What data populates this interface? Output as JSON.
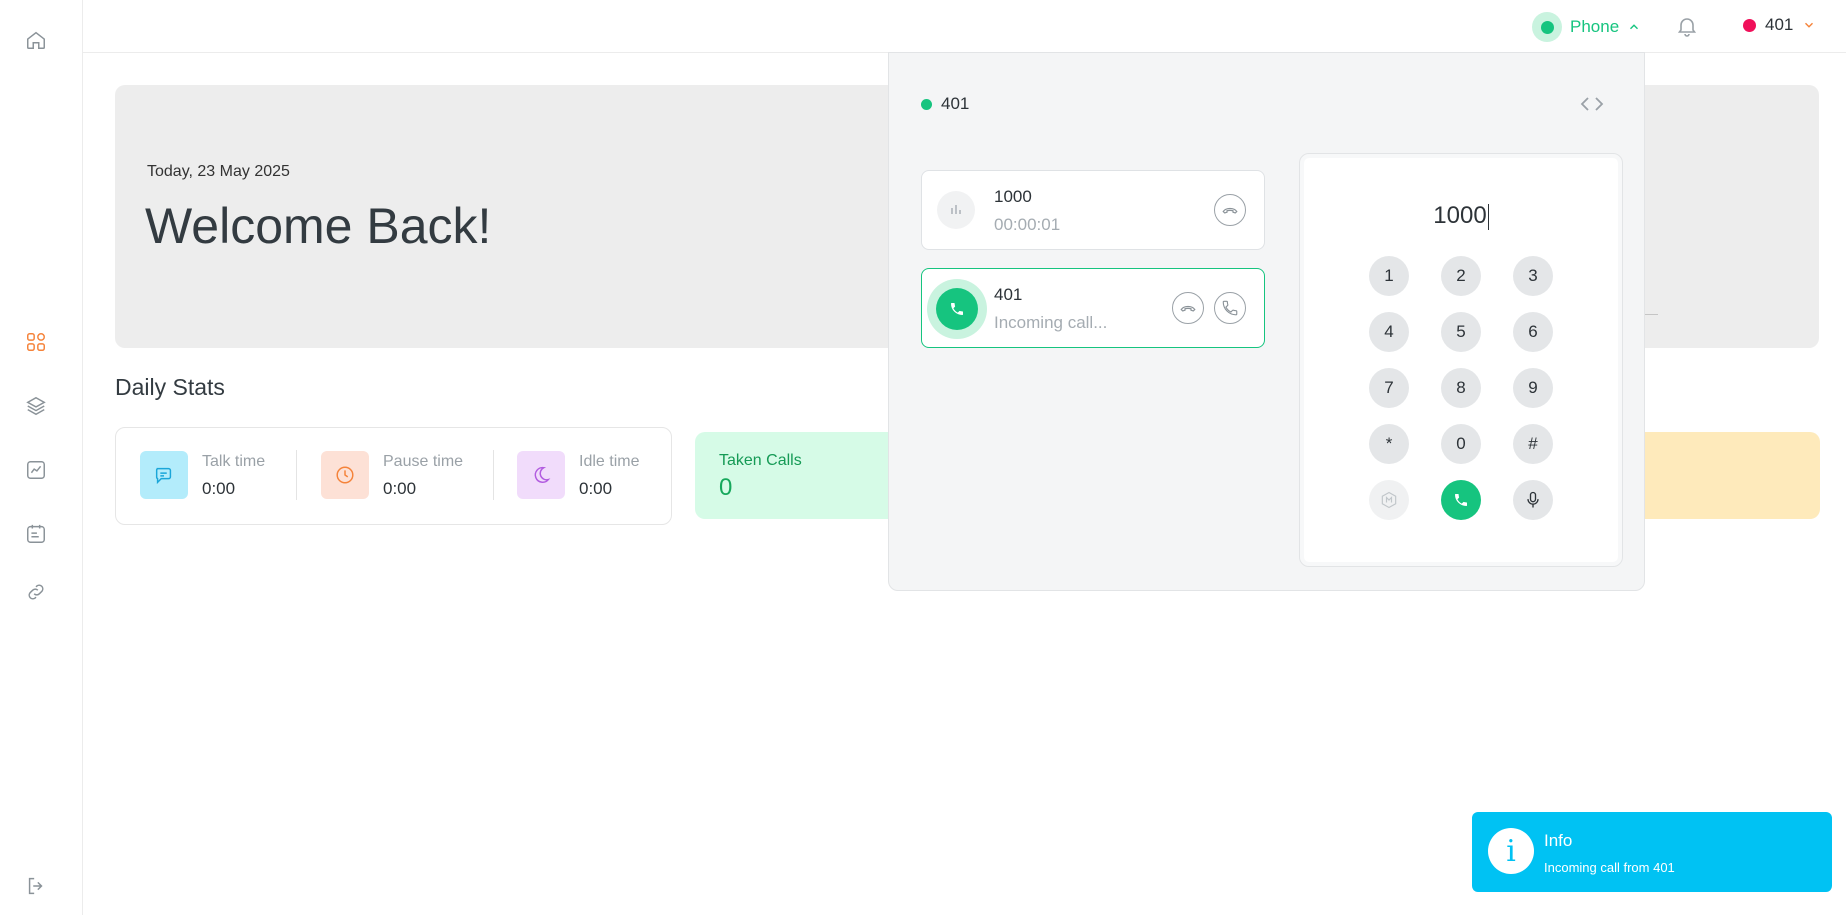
{
  "topbar": {
    "phone_label": "Phone",
    "user_ext": "401"
  },
  "hero": {
    "date": "Today, 23 May 2025",
    "title": "Welcome Back!"
  },
  "daily_stats": {
    "title": "Daily Stats",
    "items": [
      {
        "label": "Talk time",
        "value": "0:00",
        "icon": "chat-icon",
        "color": "#b3ecfb"
      },
      {
        "label": "Pause time",
        "value": "0:00",
        "icon": "clock-icon",
        "color": "#fde1d6"
      },
      {
        "label": "Idle time",
        "value": "0:00",
        "icon": "moon-icon",
        "color": "#f1dcfb"
      }
    ],
    "taken_calls": {
      "label": "Taken Calls",
      "value": "0"
    }
  },
  "phone_panel": {
    "extension": "401",
    "calls": [
      {
        "number": "1000",
        "status": "00:00:01",
        "state": "active"
      },
      {
        "number": "401",
        "status": "Incoming call...",
        "state": "incoming"
      }
    ],
    "dialer": {
      "display": "1000",
      "keys": [
        "1",
        "2",
        "3",
        "4",
        "5",
        "6",
        "7",
        "8",
        "9",
        "*",
        "0",
        "#"
      ]
    }
  },
  "toast": {
    "title": "Info",
    "message": "Incoming call from 401",
    "icon": "i"
  },
  "colors": {
    "accent_green": "#16c47f",
    "accent_orange": "#f5833a",
    "info_blue": "#00c2f3",
    "status_red": "#f0105a"
  }
}
